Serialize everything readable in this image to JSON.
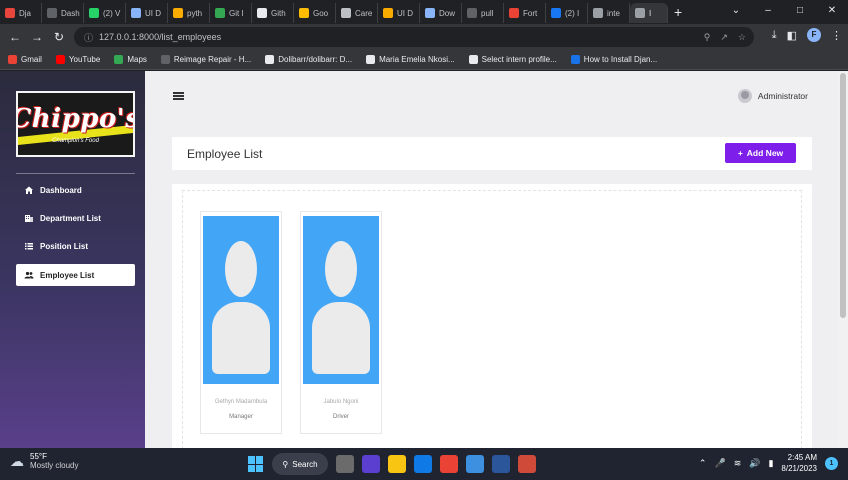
{
  "browser": {
    "tabs": [
      {
        "label": "Dja",
        "color": "#e8453c"
      },
      {
        "label": "Dash",
        "color": "#5f6368"
      },
      {
        "label": "(2) V",
        "color": "#25d366"
      },
      {
        "label": "UI D",
        "color": "#8ab4f8"
      },
      {
        "label": "pyth",
        "color": "#f9ab00"
      },
      {
        "label": "Git I",
        "color": "#34a853"
      },
      {
        "label": "Gith",
        "color": "#e8eaed"
      },
      {
        "label": "Goo",
        "color": "#fbbc04"
      },
      {
        "label": "Care",
        "color": "#bdc1c6"
      },
      {
        "label": "UI D",
        "color": "#f9ab00"
      },
      {
        "label": "Dow",
        "color": "#8ab4f8"
      },
      {
        "label": "pull",
        "color": "#5f6368"
      },
      {
        "label": "Fort",
        "color": "#ea4335"
      },
      {
        "label": "(2) I",
        "color": "#1877f2"
      },
      {
        "label": "inte",
        "color": "#9aa0a6"
      },
      {
        "label": "I",
        "color": "#9aa0a6"
      }
    ],
    "active_tab_index": 15,
    "url": "127.0.0.1:8000/list_employees",
    "profile_initial": "F",
    "bookmarks": [
      {
        "label": "Gmail",
        "color": "#ea4335"
      },
      {
        "label": "YouTube",
        "color": "#ff0000"
      },
      {
        "label": "Maps",
        "color": "#34a853"
      },
      {
        "label": "Reimage Repair - H...",
        "color": "#5f6368"
      },
      {
        "label": "Dolibarr/dolibarr: D...",
        "color": "#e8eaed"
      },
      {
        "label": "Maria Emelia Nkosi...",
        "color": "#e8eaed"
      },
      {
        "label": "Select intern profile...",
        "color": "#e8eaed"
      },
      {
        "label": "How to Install Djan...",
        "color": "#1a73e8"
      }
    ]
  },
  "sidebar": {
    "logo_text": "Chippo's",
    "logo_subtext": "Champion's Food",
    "items": [
      {
        "label": "Dashboard",
        "icon": "home-icon",
        "active": false
      },
      {
        "label": "Department List",
        "icon": "building-icon",
        "active": false
      },
      {
        "label": "Position List",
        "icon": "list-icon",
        "active": false
      },
      {
        "label": "Employee List",
        "icon": "people-icon",
        "active": true
      }
    ]
  },
  "topbar": {
    "user_label": "Administrator"
  },
  "header": {
    "title": "Employee List",
    "add_button_label": "Add New"
  },
  "employees": [
    {
      "name": "Gethyn Madambula",
      "position": "Manager"
    },
    {
      "name": "Jabulo Ngoni",
      "position": "Driver"
    }
  ],
  "taskbar": {
    "weather_temp": "55°F",
    "weather_condition": "Mostly cloudy",
    "search_label": "Search",
    "time": "2:45 AM",
    "date": "8/21/2023",
    "notification_count": "1",
    "apps": [
      "#6b6b6b",
      "#5b3fd0",
      "#f9c513",
      "#0f7ae5",
      "#ea4335",
      "#3d8fe0",
      "#2b579a",
      "#d04a3a"
    ]
  }
}
